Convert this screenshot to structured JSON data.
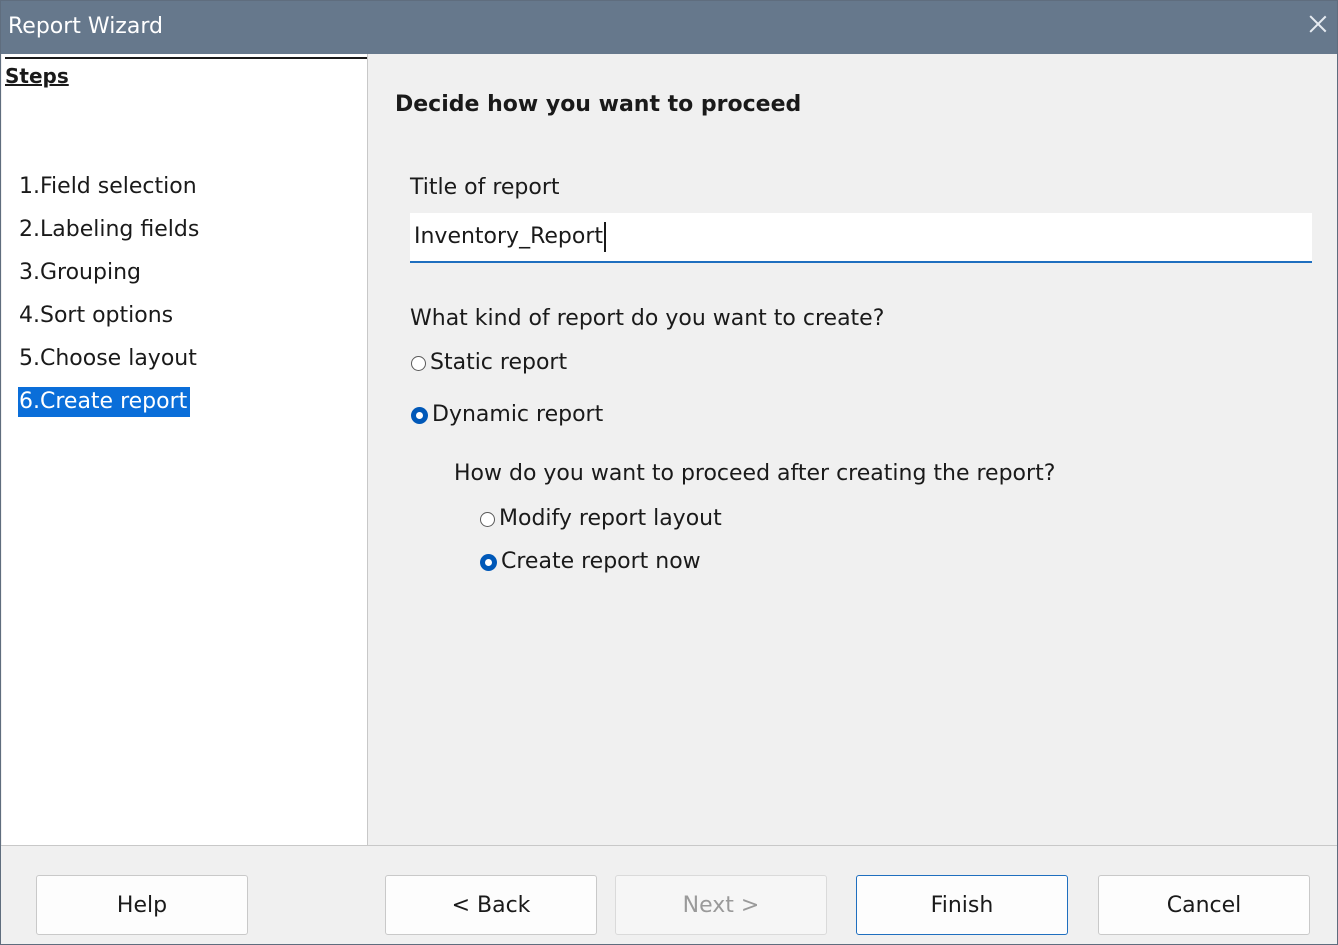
{
  "window": {
    "title": "Report Wizard"
  },
  "steps": {
    "heading": "Steps",
    "items": [
      {
        "label": "1.Field selection"
      },
      {
        "label": "2.Labeling fields"
      },
      {
        "label": "3.Grouping"
      },
      {
        "label": "4.Sort options"
      },
      {
        "label": "5.Choose layout"
      },
      {
        "label": "6.Create report",
        "active": true
      }
    ]
  },
  "main": {
    "heading": "Decide how you want to proceed",
    "title_label": "Title of report",
    "title_value": "Inventory_Report",
    "kind_question": "What kind of report do you want to create?",
    "kind_options": [
      {
        "label": "Static report",
        "selected": false
      },
      {
        "label": "Dynamic report",
        "selected": true
      }
    ],
    "proceed_question": "How do you want to proceed after creating the report?",
    "proceed_options": [
      {
        "label": "Modify report layout",
        "selected": false
      },
      {
        "label": "Create report now",
        "selected": true
      }
    ]
  },
  "footer": {
    "help": "Help",
    "back": "< Back",
    "next": "Next >",
    "finish": "Finish",
    "cancel": "Cancel"
  },
  "colors": {
    "titlebar": "#66788c",
    "selection": "#0a6ed9",
    "accent": "#1f6fbf"
  },
  "icons": {
    "close": "close-icon"
  }
}
